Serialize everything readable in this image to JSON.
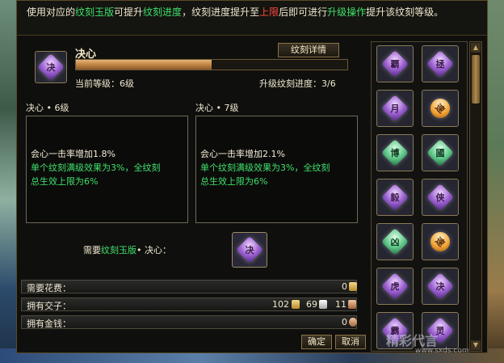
{
  "notice": {
    "prefix": "使用对应的",
    "item1": "纹刻玉版",
    "mid1": "可提升",
    "item2": "纹刻进度",
    "mid2": "，纹刻进度提升至",
    "item3": "上限",
    "mid3": "后即可进行",
    "item4": "升级操作",
    "suffix": "提升该纹刻等级。"
  },
  "header": {
    "skill_icon_char": "决",
    "title": "决心",
    "detail_button": "纹刻详情",
    "progress_fraction": 0.5,
    "current_level": "当前等级：6级",
    "upgrade_progress": "升级纹刻进度：3/6"
  },
  "current_box": {
    "heading": "决心 • 6级",
    "line1": "会心一击率增加1.8%",
    "line2": "单个纹刻满级效果为3%，全纹刻",
    "line3": "总生效上限为6%"
  },
  "next_box": {
    "heading": "决心 • 7级",
    "line1": "会心一击率增加2.1%",
    "line2": "单个纹刻满级效果为3%，全纹刻",
    "line3": "总生效上限为6%"
  },
  "requirement": {
    "pre": "需要",
    "item": "纹刻玉版",
    "post": "• 决心：",
    "icon_char": "决"
  },
  "resources": {
    "cost_label": "需要花费：",
    "cost_value": "0",
    "jiaozi_label": "拥有交子：",
    "jiaozi_gold": "102",
    "jiaozi_silver": "69",
    "jiaozi_copper": "11",
    "money_label": "拥有金钱：",
    "money_value": "0"
  },
  "buttons": {
    "confirm": "确定",
    "cancel": "取消"
  },
  "grid_items": [
    {
      "char": "覇",
      "color": "purple"
    },
    {
      "char": "拯",
      "color": "purple"
    },
    {
      "char": "月",
      "color": "purple"
    },
    {
      "char": "速",
      "color": "orange"
    },
    {
      "char": "博",
      "color": "green"
    },
    {
      "char": "國",
      "color": "green"
    },
    {
      "char": "毅",
      "color": "purple"
    },
    {
      "char": "侠",
      "color": "purple"
    },
    {
      "char": "凶",
      "color": "green"
    },
    {
      "char": "速",
      "color": "orange"
    },
    {
      "char": "虎",
      "color": "purple"
    },
    {
      "char": "决",
      "color": "purple"
    },
    {
      "char": "霸",
      "color": "purple"
    },
    {
      "char": "灵",
      "color": "purple"
    }
  ],
  "watermark": {
    "text": "精彩代言",
    "url": "www.sxds.com"
  },
  "colors": {
    "highlight_green": "#3fe06a",
    "highlight_red": "#ff4a3a",
    "progress_fill": "#c08446"
  }
}
